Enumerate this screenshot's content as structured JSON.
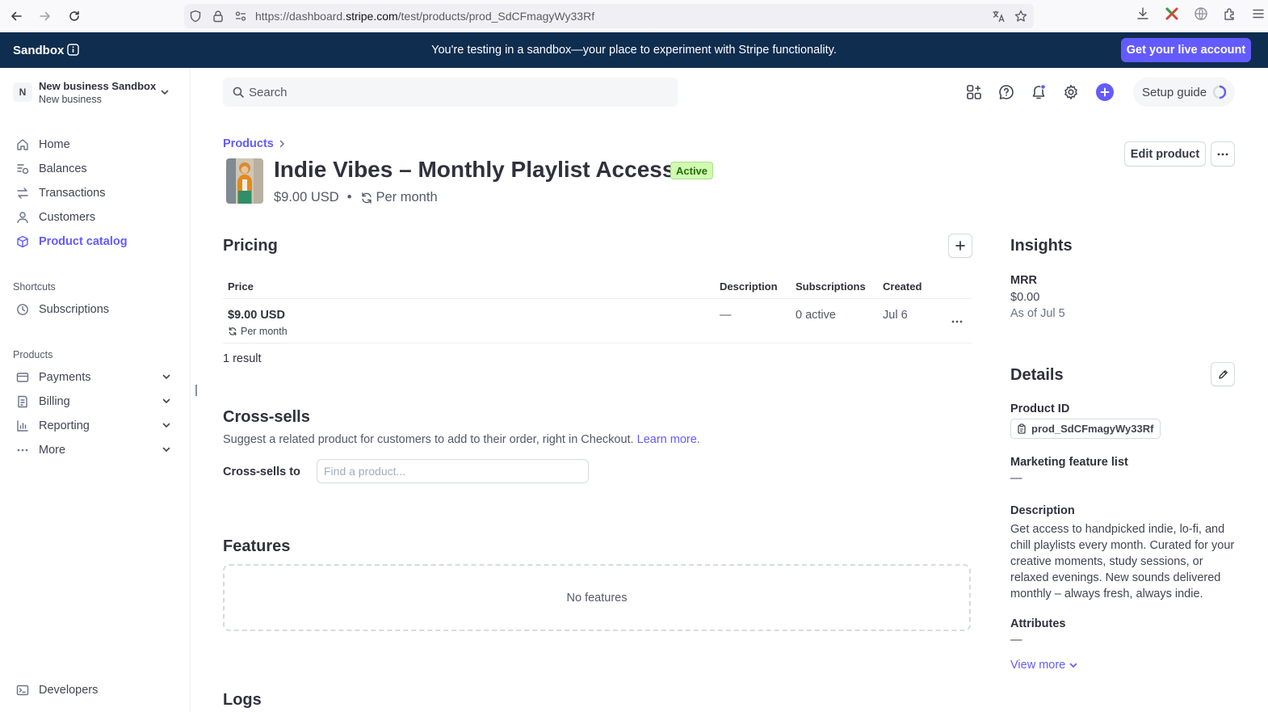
{
  "browser": {
    "url_prefix": "https://dashboard.",
    "url_host": "stripe.com",
    "url_path": "/test/products/prod_SdCFmagyWy33Rf"
  },
  "banner": {
    "label": "Sandbox",
    "message": "You're testing in a sandbox—your place to experiment with Stripe functionality.",
    "cta": "Get your live account",
    "background": "#0f2d4f",
    "cta_color": "#635bff"
  },
  "account": {
    "avatar_letter": "N",
    "name": "New business Sandbox",
    "subtitle": "New business"
  },
  "sidebar": {
    "items": [
      {
        "label": "Home",
        "icon": "home-icon"
      },
      {
        "label": "Balances",
        "icon": "balances-icon"
      },
      {
        "label": "Transactions",
        "icon": "transactions-icon"
      },
      {
        "label": "Customers",
        "icon": "customers-icon"
      },
      {
        "label": "Product catalog",
        "icon": "product-catalog-icon",
        "active": true
      }
    ],
    "shortcuts_title": "Shortcuts",
    "shortcuts": [
      {
        "label": "Subscriptions",
        "icon": "clock-icon"
      }
    ],
    "products_title": "Products",
    "products": [
      {
        "label": "Payments",
        "icon": "payments-icon"
      },
      {
        "label": "Billing",
        "icon": "billing-icon"
      },
      {
        "label": "Reporting",
        "icon": "reporting-icon"
      },
      {
        "label": "More",
        "icon": "more-icon"
      }
    ],
    "developers": "Developers"
  },
  "toolbar": {
    "search_placeholder": "Search",
    "setup_guide": "Setup guide"
  },
  "product": {
    "breadcrumb": "Products",
    "title": "Indie Vibes – Monthly Playlist Access",
    "status": "Active",
    "price": "$9.00 USD",
    "interval": "Per month",
    "edit_label": "Edit product"
  },
  "pricing": {
    "title": "Pricing",
    "columns": {
      "price": "Price",
      "description": "Description",
      "subscriptions": "Subscriptions",
      "created": "Created"
    },
    "rows": [
      {
        "price": "$9.00 USD",
        "interval": "Per month",
        "description": "—",
        "subscriptions": "0 active",
        "created": "Jul 6"
      }
    ],
    "results": "1 result"
  },
  "cross_sells": {
    "title": "Cross-sells",
    "description": "Suggest a related product for customers to add to their order, right in Checkout.",
    "learn_more": "Learn more.",
    "label": "Cross-sells to",
    "placeholder": "Find a product..."
  },
  "features": {
    "title": "Features",
    "empty": "No features"
  },
  "logs": {
    "title": "Logs"
  },
  "insights": {
    "title": "Insights",
    "mrr_label": "MRR",
    "mrr_value": "$0.00",
    "mrr_asof": "As of Jul 5"
  },
  "details": {
    "title": "Details",
    "product_id_label": "Product ID",
    "product_id": "prod_SdCFmagyWy33Rf",
    "marketing_label": "Marketing feature list",
    "marketing_value": "—",
    "description_label": "Description",
    "description": "Get access to handpicked indie, lo-fi, and chill playlists every month. Curated for your creative moments, study sessions, or relaxed evenings. New sounds delivered monthly – always fresh, always indie.",
    "attributes_label": "Attributes",
    "attributes_value": "—",
    "view_more": "View more"
  }
}
